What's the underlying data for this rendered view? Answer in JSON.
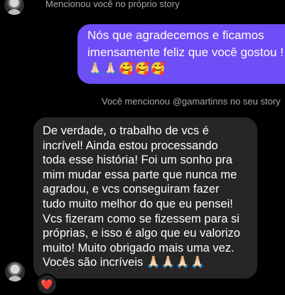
{
  "thread": {
    "mention_top": "Mencionou você no próprio story",
    "mention_mid": "Você mencionou @gamartinns no seu story"
  },
  "sent_message": {
    "lines": [
      "Nós que agradecemos e ficamos",
      "imensamente feliz que você gostou !"
    ],
    "emojis": "🙏🏻🙏🏻🥰🥰🥰"
  },
  "received_message": {
    "lines": [
      "De verdade, o trabalho de vcs é",
      "incrível! Ainda estou processando",
      "toda esse história! Foi um sonho pra",
      "mim mudar essa parte que nunca me",
      "agradou, e vcs conseguiram fazer",
      "tudo muito melhor do que eu pensei!",
      "Vcs fizeram como se fizessem para si",
      "próprias, e isso é algo que eu valorizo",
      "muito! Muito obrigado mais uma vez.",
      "Vocês são incríveis 🙏🏻🙏🏻🙏🏻🙏🏻"
    ]
  },
  "reaction": {
    "emoji": "❤️"
  },
  "colors": {
    "background": "#000000",
    "sent_bubble": "#6e4ef6",
    "received_bubble": "#262626",
    "meta_text": "#a8a8a8"
  }
}
